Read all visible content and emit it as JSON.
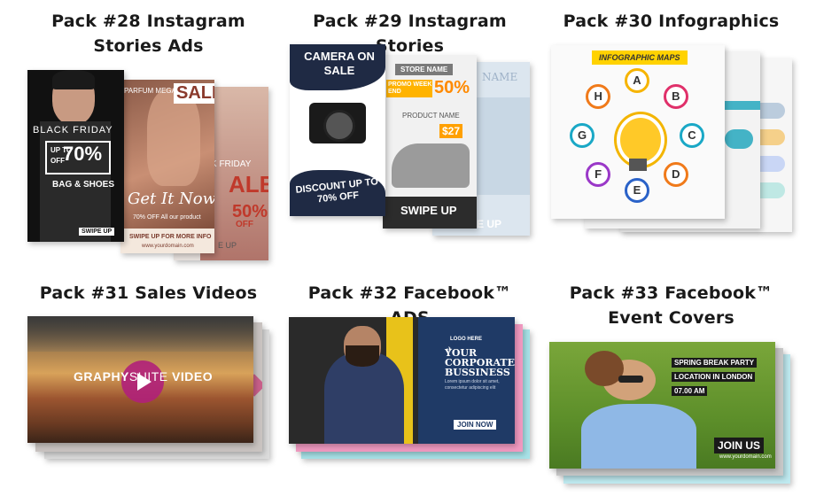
{
  "packs": [
    {
      "title": "Pack #28 Instagram Stories Ads",
      "thumb": {
        "headline1": "BLACK FRIDAY",
        "deal": "UP TO 70% OFF",
        "deal_up": "UP TO",
        "deal_pct": "70%",
        "deal_off": "OFF",
        "sub": "BAG & SHOES",
        "swipe": "SWIPE UP",
        "brand": "PARFUM MEGA",
        "sale": "SALE",
        "script": "Get It Now",
        "offer": "70% OFF All our product",
        "swipe2": "SWIPE UP FOR MORE INFO",
        "site": "www.yourdomain.com",
        "back_head": "K FRIDAY",
        "back_sale": "ALE",
        "back_pct": "50%",
        "back_off": "OFF",
        "back_swipe": "E UP"
      }
    },
    {
      "title": "Pack #29 Instagram Stories",
      "thumb": {
        "camera": "CAMERA ON SALE",
        "discount": "DISCOUNT UP TO 70% OFF",
        "store": "STORE NAME",
        "promo": "PROMO WEEK END",
        "pct": "50%",
        "product": "PRODUCT NAME",
        "price": "$27",
        "swipe": "SWIPE UP",
        "back_name": "NAME",
        "back_swipe": "E UP"
      }
    },
    {
      "title": "Pack #30 Infographics",
      "thumb": {
        "banner": "INFOGRAPHIC MAPS",
        "letters": [
          "A",
          "B",
          "C",
          "D",
          "E",
          "F",
          "G",
          "H"
        ]
      }
    },
    {
      "title": "Pack #31 Sales Videos",
      "thumb": {
        "brand": "GRAPHY",
        "brand2": "SUITE",
        "brand3": "VIDEO"
      }
    },
    {
      "title": "Pack #32 Facebook™ ADS",
      "thumb": {
        "logo": "LOGO HERE",
        "h1": "YOUR",
        "h2": "CORPORATE",
        "h3": "BUSSINESS",
        "lorem": "Lorem ipsum dolor sit amet, consectetur adipiscing elit",
        "cta": "JOIN NOW"
      }
    },
    {
      "title": "Pack #33 Facebook™ Event Covers",
      "thumb": {
        "l1": "SPRING BREAK PARTY",
        "l2": "LOCATION IN LONDON",
        "l3": "07.00 AM",
        "cta": "JOIN US",
        "site": "www.yourdomain.com"
      }
    }
  ],
  "colors": {
    "title": "#1a1a1a",
    "play": "#b0207a",
    "navy": "#1f2a44"
  }
}
